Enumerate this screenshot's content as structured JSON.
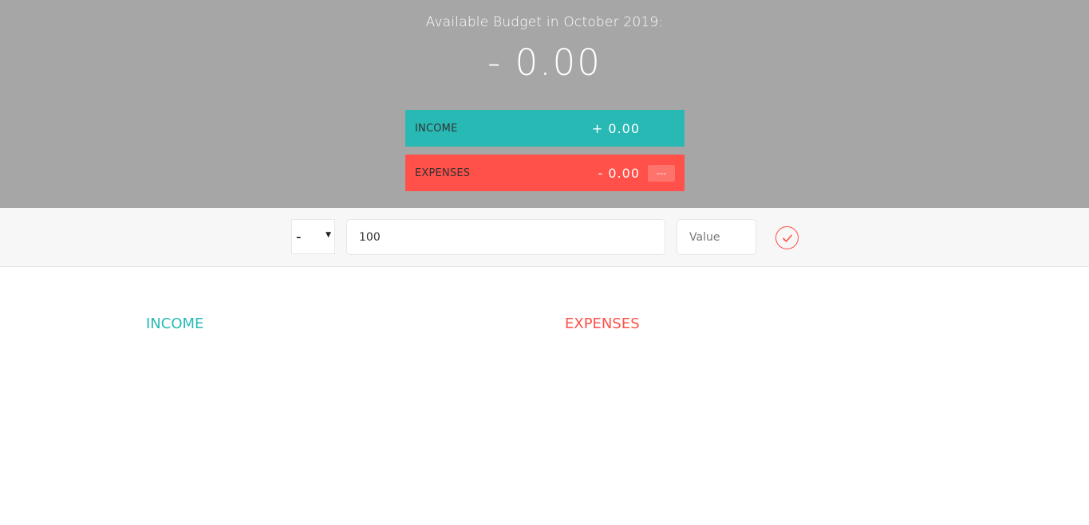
{
  "header": {
    "title": "Available Budget in October 2019:",
    "budget_value": "- 0.00"
  },
  "summary": {
    "income": {
      "label": "INCOME",
      "value": "+ 0.00"
    },
    "expenses": {
      "label": "EXPENSES",
      "value": "- 0.00",
      "percentage": "---"
    }
  },
  "add_form": {
    "type_selected": "-",
    "description_value": "100",
    "value_placeholder": "Value"
  },
  "lists": {
    "income_title": "INCOME",
    "expenses_title": "EXPENSES"
  },
  "colors": {
    "income": "#28b9b5",
    "expenses": "#ff5049",
    "header_bg": "#a6a6a6"
  },
  "icons": {
    "submit": "checkmark-circle-icon",
    "select_caret": "caret-down-icon"
  }
}
